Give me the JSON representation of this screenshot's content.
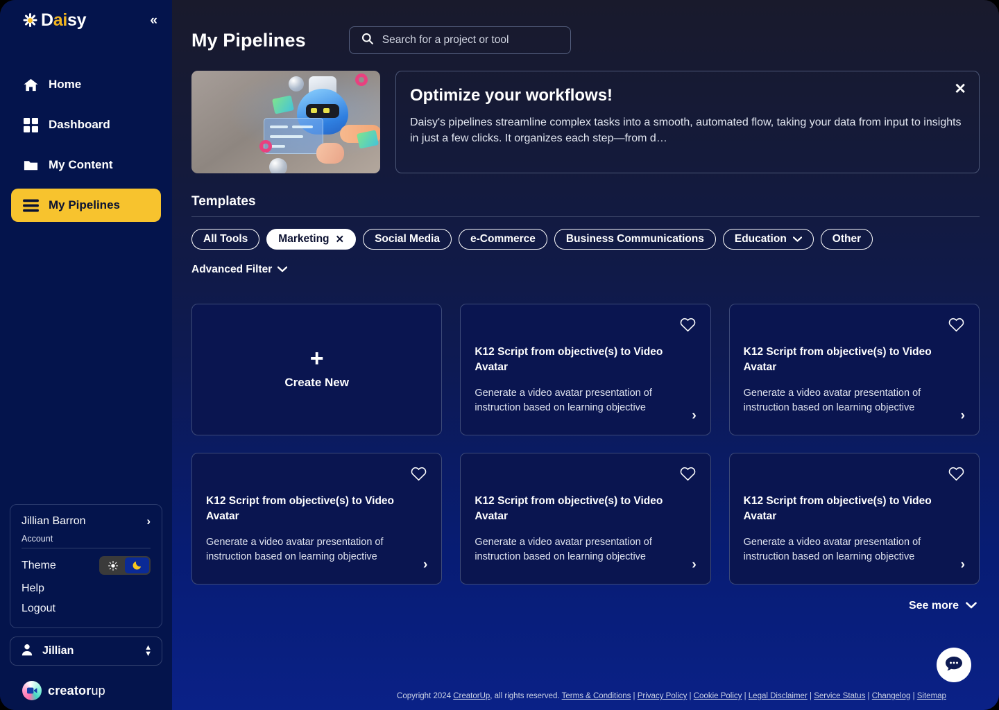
{
  "sidebar": {
    "logo": {
      "text_a": "D",
      "text_b": "ai",
      "text_c": "sy",
      "collapse_icon": "chevrons-left"
    },
    "items": [
      {
        "label": "Home",
        "icon": "home-icon"
      },
      {
        "label": "Dashboard",
        "icon": "grid-icon"
      },
      {
        "label": "My Content",
        "icon": "folder-icon"
      },
      {
        "label": "My Pipelines",
        "icon": "menu-lines-icon"
      }
    ],
    "account": {
      "name": "Jillian Barron",
      "section_label": "Account",
      "theme_label": "Theme",
      "theme_mode": "dark",
      "help_label": "Help",
      "logout_label": "Logout"
    },
    "user_select": {
      "name": "Jillian"
    },
    "brand": {
      "name_a": "creator",
      "name_b": "up"
    }
  },
  "header": {
    "title": "My Pipelines",
    "search_placeholder": "Search for a project or tool",
    "search_value": ""
  },
  "banner": {
    "title": "Optimize your workflows!",
    "body": "Daisy's pipelines streamline complex tasks into a smooth, automated flow, taking your data from input to insights in just a few clicks. It organizes each step—from d…",
    "close_label": "✕"
  },
  "templates": {
    "section_title": "Templates",
    "chips": [
      {
        "label": "All Tools",
        "selected": false,
        "has_close": false,
        "has_caret": false
      },
      {
        "label": "Marketing",
        "selected": true,
        "has_close": true,
        "has_caret": false
      },
      {
        "label": "Social Media",
        "selected": false,
        "has_close": false,
        "has_caret": false
      },
      {
        "label": "e-Commerce",
        "selected": false,
        "has_close": false,
        "has_caret": false
      },
      {
        "label": "Business Communications",
        "selected": false,
        "has_close": false,
        "has_caret": false
      },
      {
        "label": "Education",
        "selected": false,
        "has_close": false,
        "has_caret": true
      },
      {
        "label": "Other",
        "selected": false,
        "has_close": false,
        "has_caret": false
      }
    ],
    "advanced_filter_label": "Advanced Filter",
    "create_new_label": "Create New",
    "cards": [
      {
        "title": "K12 Script from objective(s) to Video Avatar",
        "desc": "Generate a video avatar presentation of instruction based on learning objective"
      },
      {
        "title": "K12 Script from objective(s) to Video Avatar",
        "desc": "Generate a video avatar presentation of instruction based on learning objective"
      },
      {
        "title": "K12 Script from objective(s) to Video Avatar",
        "desc": "Generate a video avatar presentation of instruction based on learning objective"
      },
      {
        "title": "K12 Script from objective(s) to Video Avatar",
        "desc": "Generate a video avatar presentation of instruction based on learning objective"
      },
      {
        "title": "K12 Script from objective(s) to Video Avatar",
        "desc": "Generate a video avatar presentation of instruction based on learning objective"
      }
    ],
    "see_more_label": "See more"
  },
  "footer": {
    "copyright": "Copyright 2024 ",
    "company": "CreatorUp",
    "rights": ", all rights reserved. ",
    "links": [
      "Terms & Conditions",
      "Privacy Policy",
      "Cookie Policy",
      "Legal Disclaimer",
      "Service Status",
      "Changelog",
      "Sitemap"
    ]
  },
  "colors": {
    "accent_yellow": "#f7c32e",
    "sidebar_navy": "#04144c",
    "card_navy": "#0a1550",
    "bg_top": "#191a2c",
    "bg_bottom": "#0a2187"
  }
}
